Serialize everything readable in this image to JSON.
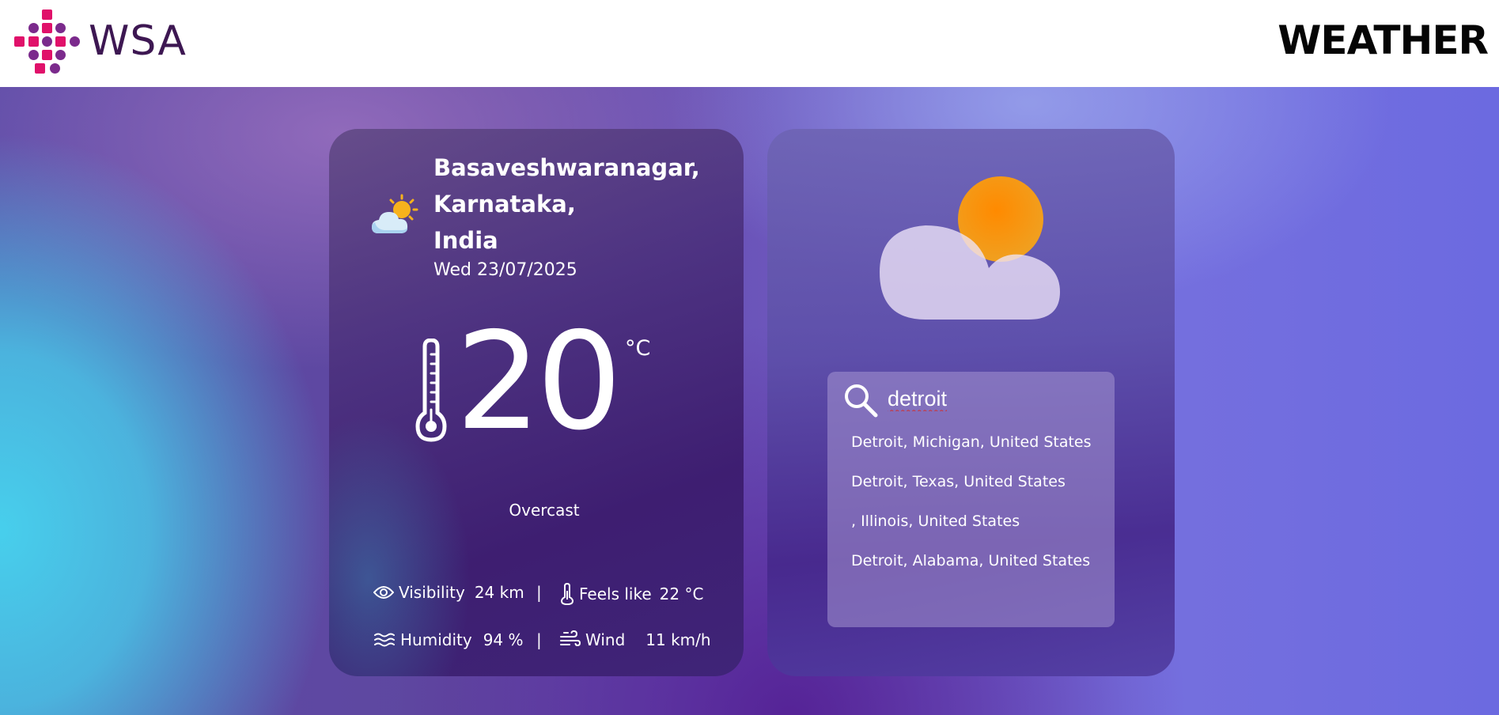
{
  "header": {
    "logo_text": "WSA",
    "title": "WEATHER",
    "logo_colors": [
      "#e0116a",
      "#7b2a8c"
    ]
  },
  "current": {
    "weather_icon": "partly-cloudy-icon",
    "location_line1": "Basaveshwaranagar,",
    "location_line2": "Karnataka,",
    "location_line3": "India",
    "date": "Wed 23/07/2025",
    "temperature": "20",
    "unit": "°C",
    "condition": "Overcast",
    "stats": {
      "visibility_label": "Visibility",
      "visibility_value": "24 km",
      "feels_like_label": "Feels like",
      "feels_like_value": "22 °C",
      "humidity_label": "Humidity",
      "humidity_value": "94 %",
      "wind_label": "Wind",
      "wind_value": "11 km/h",
      "separator": "|"
    }
  },
  "search": {
    "illustration": "cloud-sun-icon",
    "value": "detroit",
    "suggestions": [
      "Detroit, Michigan, United States",
      "Detroit, Texas, United States",
      ", Illinois, United States",
      "Detroit, Alabama, United States"
    ]
  }
}
